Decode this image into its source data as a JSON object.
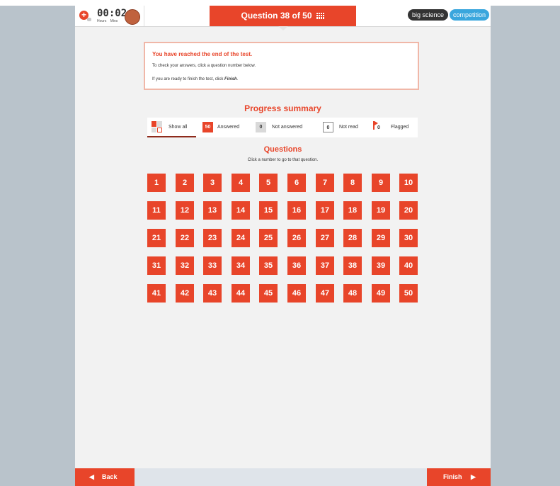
{
  "header": {
    "timer_digits": "00:02",
    "timer_units": [
      "Hours",
      "Mins"
    ],
    "clock_text": "CLOCK",
    "question_indicator": "Question 38 of 50",
    "brand_left": "big science",
    "brand_right": "competition"
  },
  "message": {
    "title": "You have reached the end of the test.",
    "line1": "To check your answers, click a question number below.",
    "line2_prefix": "If you are ready to finish the test, click ",
    "line2_emphasis": "Finish",
    "line2_suffix": "."
  },
  "progress": {
    "title": "Progress summary",
    "filters": {
      "show_all": "Show all",
      "answered_count": "50",
      "answered": "Answered",
      "not_answered_count": "0",
      "not_answered": "Not answered",
      "not_read_count": "0",
      "not_read": "Not read",
      "flagged_count": "0",
      "flagged": "Flagged"
    }
  },
  "questions": {
    "title": "Questions",
    "subtitle": "Click a number to go to that question.",
    "numbers": [
      1,
      2,
      3,
      4,
      5,
      6,
      7,
      8,
      9,
      10,
      11,
      12,
      13,
      14,
      15,
      16,
      17,
      18,
      19,
      20,
      21,
      22,
      23,
      24,
      25,
      26,
      27,
      28,
      29,
      30,
      31,
      32,
      33,
      34,
      35,
      36,
      37,
      38,
      39,
      40,
      41,
      42,
      43,
      44,
      45,
      46,
      47,
      48,
      49,
      50
    ],
    "status_color": "#e8452a"
  },
  "footer": {
    "back_label": "Back",
    "finish_label": "Finish"
  }
}
